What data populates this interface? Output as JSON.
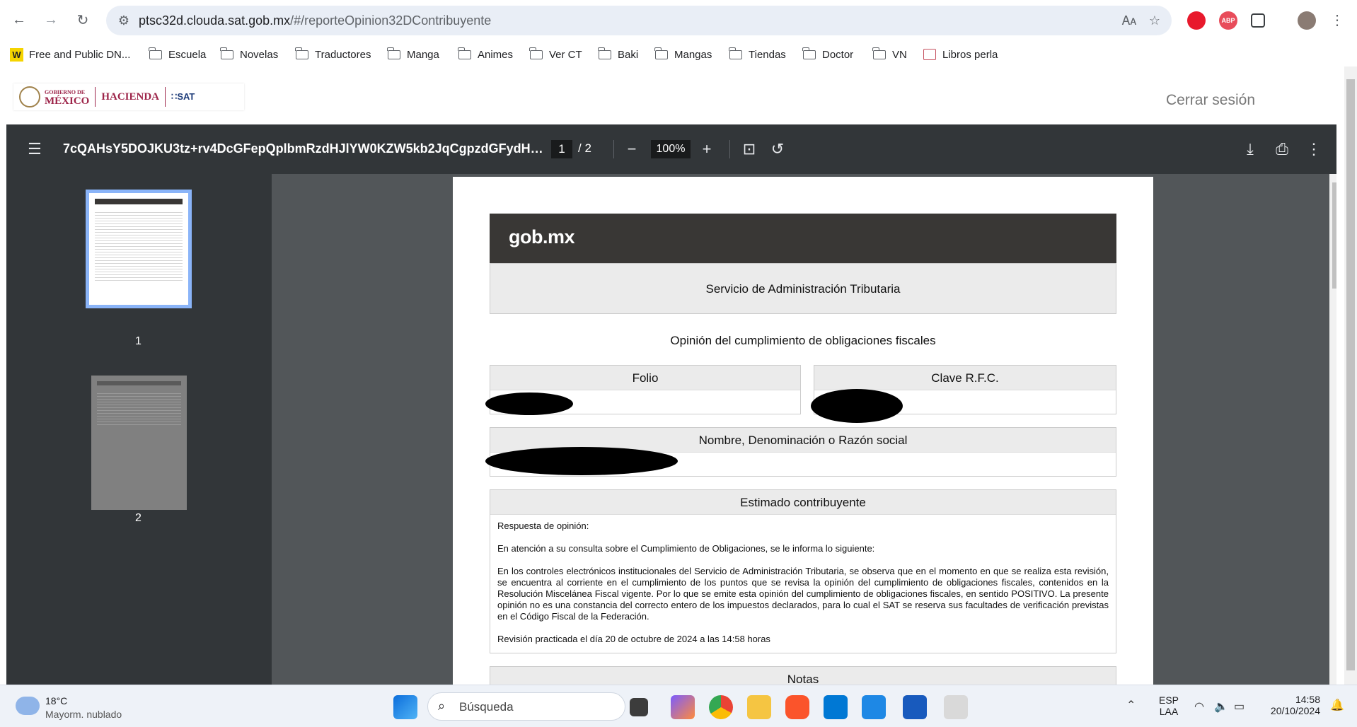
{
  "browser": {
    "url_host": "ptsc32d.clouda.sat.gob.mx",
    "url_rest": "/#/reporteOpinion32DContribuyente",
    "bookmarks": [
      {
        "label": "Free and Public DN...",
        "icon": "w-favicon"
      },
      {
        "label": "Escuela",
        "icon": "folder-icon"
      },
      {
        "label": "Novelas",
        "icon": "folder-icon"
      },
      {
        "label": "Traductores",
        "icon": "folder-icon"
      },
      {
        "label": "Manga",
        "icon": "folder-icon"
      },
      {
        "label": "Animes",
        "icon": "folder-icon"
      },
      {
        "label": "Ver CT",
        "icon": "folder-icon"
      },
      {
        "label": "Baki",
        "icon": "folder-icon"
      },
      {
        "label": "Mangas",
        "icon": "folder-icon"
      },
      {
        "label": "Tiendas",
        "icon": "folder-icon"
      },
      {
        "label": "Doctor",
        "icon": "folder-icon"
      },
      {
        "label": "VN",
        "icon": "folder-icon"
      },
      {
        "label": "Libros perla",
        "icon": "book-icon"
      }
    ]
  },
  "site": {
    "logo_gob": "GOBIERNO DE",
    "logo_mexico": "MÉXICO",
    "logo_hacienda": "HACIENDA",
    "logo_sat": "SAT",
    "logout": "Cerrar sesión"
  },
  "pdf_viewer": {
    "file_title": "7cQAHsY5DOJKU3tz+rv4DcGFepQplbmRzdHJlYW0KZW5kb2JqCgpzdGFydHhyZW...",
    "current_page": "1",
    "total_pages": "/  2",
    "zoom": "100%",
    "thumbnails": [
      "1",
      "2"
    ]
  },
  "document": {
    "banner": "gob.mx",
    "agency": "Servicio de Administración Tributaria",
    "title": "Opinión del cumplimiento de obligaciones fiscales",
    "folio_label": "Folio",
    "rfc_label": "Clave R.F.C.",
    "name_label": "Nombre, Denominación o Razón social",
    "estimado_label": "Estimado contribuyente",
    "respuesta": "Respuesta de opinión:",
    "atencion": "En atención a su consulta sobre el Cumplimiento de Obligaciones, se le informa lo siguiente:",
    "body": "En los controles electrónicos institucionales del Servicio de Administración Tributaria, se observa que en el momento en que se realiza esta revisión, se encuentra al corriente en el cumplimiento de los puntos que se revisa la opinión del cumplimiento de obligaciones fiscales, contenidos en la Resolución Miscelánea Fiscal vigente. Por lo que se emite esta opinión del cumplimiento de obligaciones fiscales, en sentido POSITIVO. La presente opinión no es una constancia del correcto entero de los impuestos declarados, para lo cual el SAT se reserva sus facultades de verificación previstas en el Código Fiscal de la Federación.",
    "revision": "Revisión practicada el día 20 de octubre de 2024 a las 14:58 horas",
    "notas_label": "Notas"
  },
  "taskbar": {
    "weather_temp": "18°C",
    "weather_desc": "Mayorm. nublado",
    "search_placeholder": "Búsqueda",
    "lang": "ESP",
    "lang_sub": "LAA",
    "time": "14:58",
    "date": "20/10/2024"
  }
}
